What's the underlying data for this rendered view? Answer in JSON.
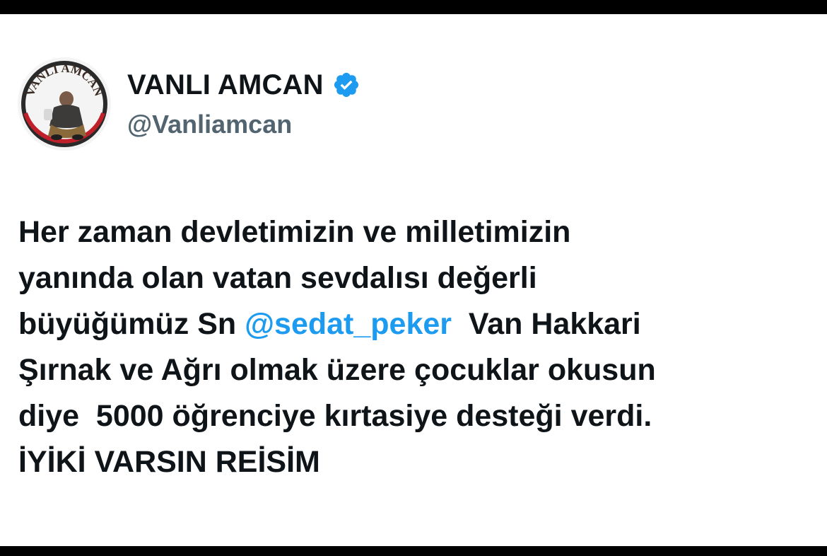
{
  "profile": {
    "display_name": "VANLI AMCAN",
    "handle": "@Vanliamcan",
    "avatar_text": "VANLI AMCAN",
    "verified_icon": "verified-badge-icon",
    "verified_color": "#1d9bf0"
  },
  "tweet": {
    "line1": "Her zaman devletimizin ve milletimizin",
    "line2": "yanında olan vatan sevdalısı değerli",
    "line3_pre": "büyüğümüz Sn ",
    "mention": "@sedat_peker",
    "line3_post": "  Van Hakkari",
    "line4": "Şırnak ve Ağrı olmak üzere çocuklar okusun",
    "line5": "diye  5000 öğrenciye kırtasiye desteği verdi.",
    "line6": "İYİKİ VARSIN REİSİM"
  },
  "colors": {
    "text": "#0f1419",
    "secondary": "#536471",
    "link": "#1d9bf0",
    "background": "#ffffff",
    "frame": "#000000"
  }
}
